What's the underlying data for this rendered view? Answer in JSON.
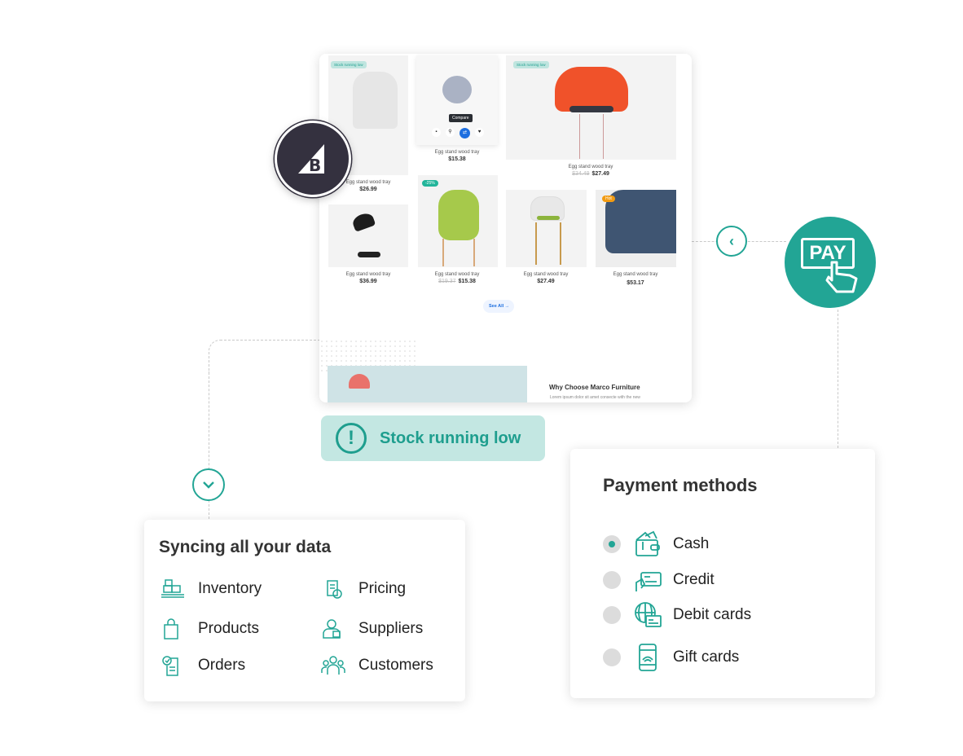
{
  "store": {
    "products": [
      {
        "name": "Egg stand wood tray",
        "price": "$26.99",
        "tag": "Stock running low"
      },
      {
        "name": "Egg stand wood tray",
        "price": "$15.38",
        "tooltip": "Compare"
      },
      {
        "name": "Egg stand wood tray",
        "price": "$27.49",
        "old_price": "$34.49",
        "tag": "Stock running low"
      },
      {
        "name": "Egg stand wood tray",
        "price": "$36.99"
      },
      {
        "name": "Egg stand wood tray",
        "price": "$15.38",
        "old_price": "$19.37",
        "badge": "-25%"
      },
      {
        "name": "Egg stand wood tray",
        "price": "$27.49"
      },
      {
        "name": "Egg stand wood tray",
        "price": "$53.17",
        "badge": "Hot"
      }
    ],
    "see_all": "See All",
    "why_title": "Why Choose Marco Furniture",
    "why_text": "Lorem ipsum dolor sit amet consecte with the new"
  },
  "logo": "BigCommerce",
  "pay_icon_text": "PAY",
  "stock_alert": "Stock running low",
  "sync": {
    "title": "Syncing all your data",
    "items": [
      {
        "label": "Inventory",
        "icon": "inventory-icon"
      },
      {
        "label": "Pricing",
        "icon": "pricing-icon"
      },
      {
        "label": "Products",
        "icon": "shopping-bag-icon"
      },
      {
        "label": "Suppliers",
        "icon": "supplier-icon"
      },
      {
        "label": "Orders",
        "icon": "orders-icon"
      },
      {
        "label": "Customers",
        "icon": "customers-icon"
      }
    ]
  },
  "payment": {
    "title": "Payment methods",
    "methods": [
      {
        "label": "Cash",
        "selected": true
      },
      {
        "label": "Credit",
        "selected": false
      },
      {
        "label": "Debit cards",
        "selected": false
      },
      {
        "label": "Gift cards",
        "selected": false
      }
    ]
  },
  "colors": {
    "accent": "#22a595",
    "alert_bg": "#c3e7e2",
    "logo_dark": "#34313f"
  }
}
